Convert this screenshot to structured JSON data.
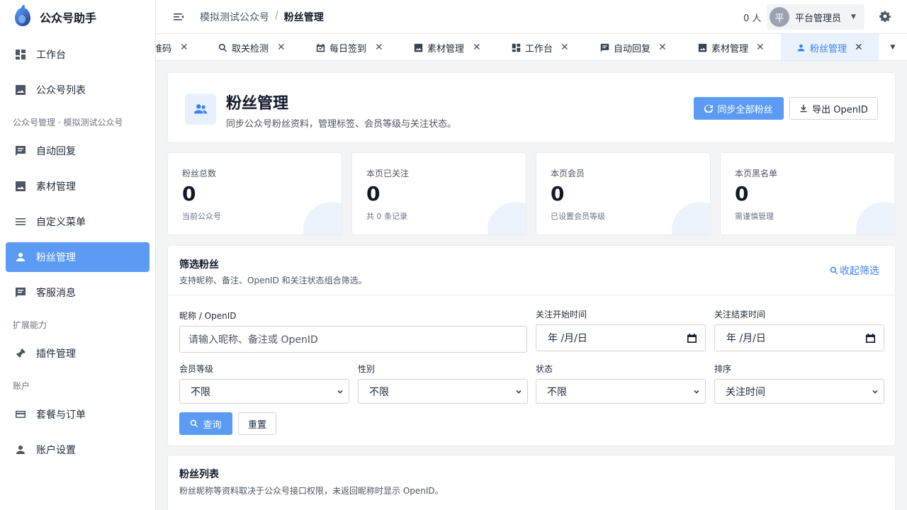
{
  "brand": {
    "name": "公众号助手"
  },
  "sidebar": {
    "items": [
      {
        "label": "工作台",
        "icon": "dashboard-icon"
      },
      {
        "label": "公众号列表",
        "icon": "image-icon"
      },
      {
        "label": "自动回复",
        "icon": "message-icon"
      },
      {
        "label": "素材管理",
        "icon": "image-icon"
      },
      {
        "label": "自定义菜单",
        "icon": "menu-icon"
      },
      {
        "label": "粉丝管理",
        "icon": "person-icon",
        "active": true
      },
      {
        "label": "客服消息",
        "icon": "message-icon"
      },
      {
        "label": "插件管理",
        "icon": "plugin-icon"
      },
      {
        "label": "套餐与订单",
        "icon": "card-icon"
      },
      {
        "label": "账户设置",
        "icon": "person-icon"
      }
    ],
    "sections": [
      "公众号管理 · 模拟测试公众号",
      "扩展能力",
      "账户"
    ]
  },
  "header": {
    "breadcrumb": [
      "模拟测试公众号",
      "/",
      "粉丝管理"
    ],
    "user_count": "0 人",
    "avatar_text": "平",
    "user_name": "平台管理员"
  },
  "tabs": [
    {
      "label": "维码"
    },
    {
      "label": "取关检测",
      "icon": "search-icon"
    },
    {
      "label": "每日签到",
      "icon": "calendar-check-icon"
    },
    {
      "label": "素材管理",
      "icon": "image-icon"
    },
    {
      "label": "工作台",
      "icon": "dashboard-icon"
    },
    {
      "label": "自动回复",
      "icon": "message-icon"
    },
    {
      "label": "素材管理",
      "icon": "image-icon"
    },
    {
      "label": "粉丝管理",
      "icon": "person-icon",
      "active": true
    }
  ],
  "page": {
    "title": "粉丝管理",
    "desc": "同步公众号粉丝资料，管理标签、会员等级与关注状态。",
    "sync_label": "同步全部粉丝",
    "export_label": "导出 OpenID"
  },
  "stats": [
    {
      "label": "粉丝总数",
      "value": "0",
      "sub": "当前公众号"
    },
    {
      "label": "本页已关注",
      "value": "0",
      "sub": "共 0 条记录"
    },
    {
      "label": "本页会员",
      "value": "0",
      "sub": "已设置会员等级"
    },
    {
      "label": "本页黑名单",
      "value": "0",
      "sub": "需谨慎管理"
    }
  ],
  "filter": {
    "title": "筛选粉丝",
    "desc": "支持昵称、备注、OpenID 和关注状态组合筛选。",
    "collapse_label": "收起筛选",
    "nickname_label": "昵称 / OpenID",
    "nickname_placeholder": "请输入昵称、备注或 OpenID",
    "start_label": "关注开始时间",
    "end_label": "关注结束时间",
    "date_placeholder": "年 /月/日",
    "level_label": "会员等级",
    "level_value": "不限",
    "gender_label": "性别",
    "gender_value": "不限",
    "status_label": "状态",
    "status_value": "不限",
    "sort_label": "排序",
    "sort_value": "关注时间",
    "query_label": "查询",
    "reset_label": "重置"
  },
  "list": {
    "title": "粉丝列表",
    "desc": "粉丝昵称等资料取决于公众号接口权限，未返回昵称时显示 OpenID。"
  }
}
